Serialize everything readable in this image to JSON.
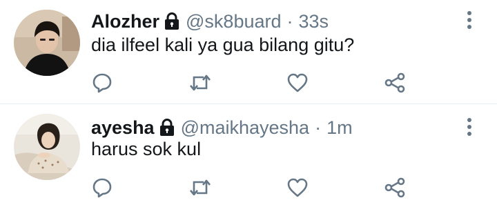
{
  "tweets": [
    {
      "display_name": "Alozher",
      "handle": "@sk8buard",
      "separator": "·",
      "time": "33s",
      "text": "dia ilfeel kali ya gua bilang gitu?",
      "protected_icon": "lock-icon",
      "actions": [
        "reply-icon",
        "retweet-icon",
        "like-icon",
        "share-icon"
      ]
    },
    {
      "display_name": "ayesha",
      "handle": "@maikhayesha",
      "separator": "·",
      "time": "1m",
      "text": "harus sok kul",
      "protected_icon": "lock-icon",
      "actions": [
        "reply-icon",
        "retweet-icon",
        "like-icon",
        "share-icon"
      ]
    }
  ],
  "colors": {
    "name": "#14171a",
    "secondary": "#657786",
    "icon": "#657786",
    "divider": "#e6ecf0",
    "background": "#ffffff"
  }
}
